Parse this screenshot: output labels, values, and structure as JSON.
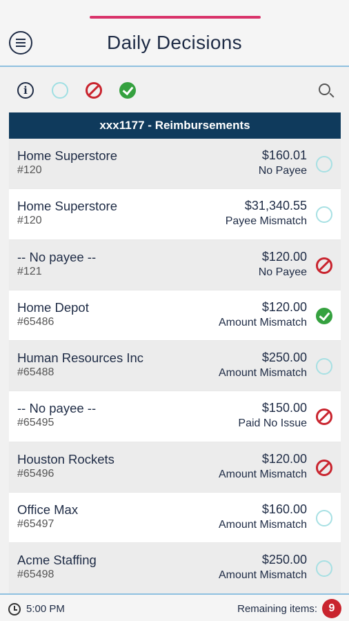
{
  "header": {
    "title": "Daily Decisions",
    "accent_color": "#d9336a"
  },
  "filters": {
    "icons": [
      "info-icon",
      "pending-circle-icon",
      "block-icon",
      "check-icon",
      "search-icon"
    ]
  },
  "account": {
    "title": "xxx1177 - Reimbursements"
  },
  "items": [
    {
      "payee": "Home Superstore",
      "ref": "#120",
      "amount": "$160.01",
      "issue": "No Payee",
      "status": "pending"
    },
    {
      "payee": "Home Superstore",
      "ref": "#120",
      "amount": "$31,340.55",
      "issue": "Payee Mismatch",
      "status": "pending"
    },
    {
      "payee": "-- No payee --",
      "ref": "#121",
      "amount": "$120.00",
      "issue": "No Payee",
      "status": "block"
    },
    {
      "payee": "Home Depot",
      "ref": "#65486",
      "amount": "$120.00",
      "issue": "Amount Mismatch",
      "status": "check"
    },
    {
      "payee": "Human Resources Inc",
      "ref": "#65488",
      "amount": "$250.00",
      "issue": "Amount Mismatch",
      "status": "pending"
    },
    {
      "payee": "-- No payee --",
      "ref": "#65495",
      "amount": "$150.00",
      "issue": "Paid No Issue",
      "status": "block"
    },
    {
      "payee": "Houston Rockets",
      "ref": "#65496",
      "amount": "$120.00",
      "issue": "Amount Mismatch",
      "status": "block"
    },
    {
      "payee": "Office Max",
      "ref": "#65497",
      "amount": "$160.00",
      "issue": "Amount Mismatch",
      "status": "pending"
    },
    {
      "payee": "Acme Staffing",
      "ref": "#65498",
      "amount": "$250.00",
      "issue": "Amount Mismatch",
      "status": "pending"
    }
  ],
  "footer": {
    "time": "5:00 PM",
    "remaining_label": "Remaining items:",
    "remaining_count": "9"
  },
  "colors": {
    "navy": "#0f3a5c",
    "reject": "#c9242e",
    "approve": "#35a13f",
    "pending": "#a6e0e3"
  }
}
